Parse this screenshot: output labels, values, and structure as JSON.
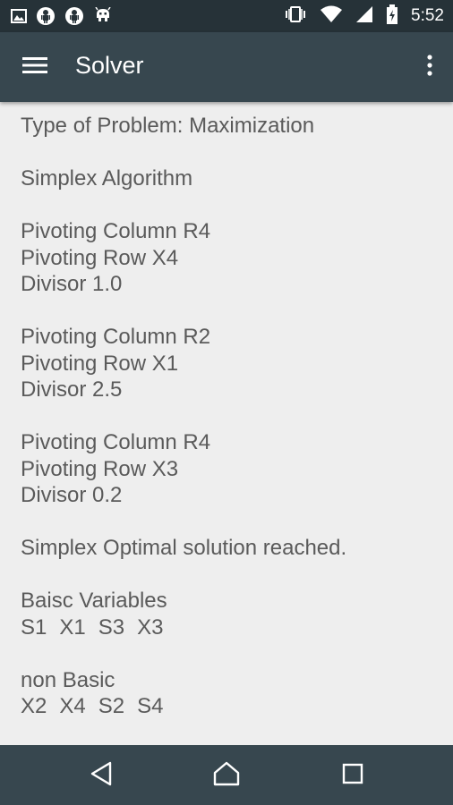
{
  "status_bar": {
    "time": "5:52",
    "icons": [
      "gallery-icon",
      "android-icon",
      "android-icon",
      "debug-icon",
      "vibrate-icon",
      "wifi-icon",
      "signal-icon",
      "battery-charging-icon"
    ]
  },
  "app_bar": {
    "title": "Solver",
    "menu_icon": "hamburger-menu-icon",
    "overflow_icon": "more-vert-icon"
  },
  "results": {
    "problem_type": "Type of Problem: Maximization",
    "algorithm": "Simplex Algorithm",
    "iterations": [
      {
        "column": "Pivoting Column R4",
        "row": "Pivoting Row X4",
        "divisor": "Divisor 1.0"
      },
      {
        "column": "Pivoting Column R2",
        "row": "Pivoting Row X1",
        "divisor": "Divisor 2.5"
      },
      {
        "column": "Pivoting Column R4",
        "row": "Pivoting Row X3",
        "divisor": "Divisor 0.2"
      }
    ],
    "status": "Simplex Optimal solution reached.",
    "basic_label": "Baisc Variables",
    "basic_vars": [
      "S1",
      "X1",
      "S3",
      "X3"
    ],
    "nonbasic_label": "non Basic",
    "nonbasic_vars": [
      "X2",
      "X4",
      "S2",
      "S4"
    ]
  },
  "colors": {
    "status_bar": "#263238",
    "app_bar": "#37474f",
    "background": "#eeeeee",
    "text": "#5a5a5a"
  }
}
